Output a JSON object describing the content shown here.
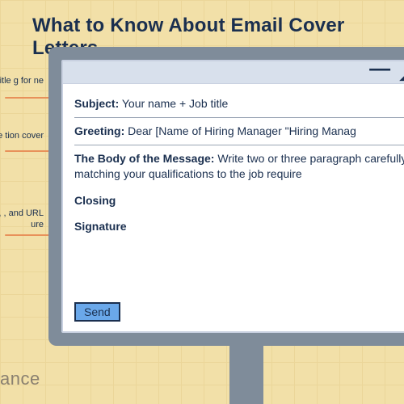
{
  "title": "What to Know About Email Cover Letters",
  "callouts": {
    "c1": "d title\ng for\nne",
    "c2": "me\ntion\ncover",
    "c3": "ull\ns,\n, and\nURL\nure"
  },
  "email": {
    "window": {
      "minimize": "—",
      "expand": "◢"
    },
    "subject_label": "Subject:",
    "subject_value": "Your name + Job title",
    "greeting_label": "Greeting:",
    "greeting_value": "Dear [Name of Hiring Manager \"Hiring Manag",
    "body_label": "The Body of the Message:",
    "body_value": "Write two or three paragraph carefully matching your qualifications to the job require",
    "closing": "Closing",
    "signature": "Signature",
    "send": "Send"
  },
  "footer": "ance"
}
